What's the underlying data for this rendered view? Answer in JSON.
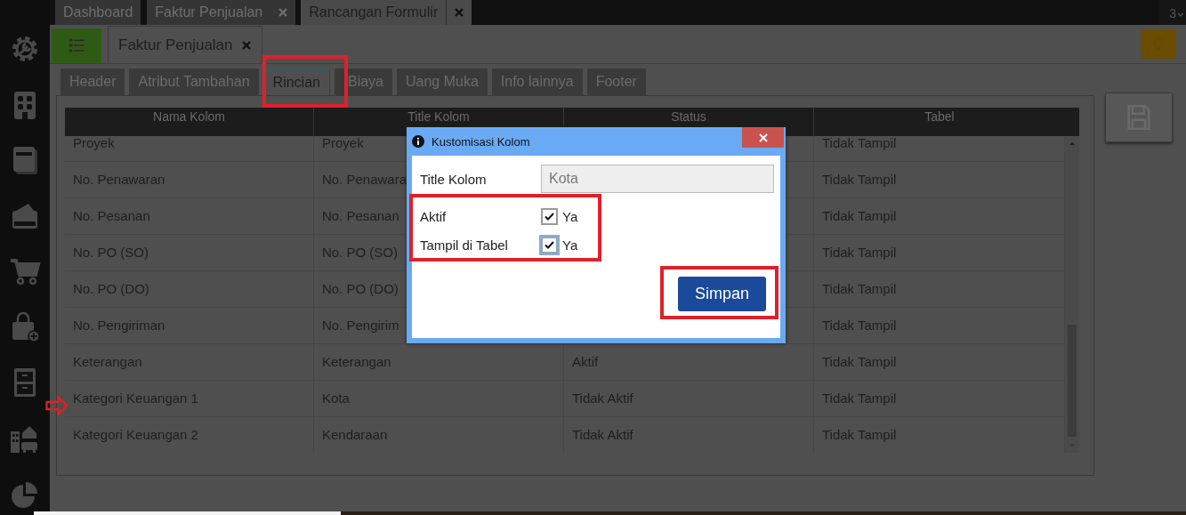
{
  "top_tabs": [
    {
      "label": "Dashboard",
      "selected": false,
      "closable": false
    },
    {
      "label": "Faktur Penjualan",
      "selected": false,
      "closable": true
    },
    {
      "label": "Rancangan Formulir",
      "selected": true,
      "closable": true
    }
  ],
  "tab_count": "3",
  "doc_tabs": [
    {
      "label": "Faktur Penjualan",
      "selected": true
    }
  ],
  "form_tabs": [
    {
      "label": "Header",
      "selected": false
    },
    {
      "label": "Atribut Tambahan",
      "selected": false
    },
    {
      "label": "Rincian",
      "selected": true
    },
    {
      "label": "Biaya",
      "selected": false
    },
    {
      "label": "Uang Muka",
      "selected": false
    },
    {
      "label": "Info lainnya",
      "selected": false
    },
    {
      "label": "Footer",
      "selected": false
    }
  ],
  "table": {
    "columns": [
      "Nama Kolom",
      "Title Kolom",
      "Status",
      "Tabel"
    ],
    "rows": [
      {
        "cells": [
          "Proyek",
          "Proyek",
          null,
          "Tidak Tampil"
        ]
      },
      {
        "cells": [
          "No. Penawaran",
          "No. Penawara",
          null,
          "Tidak Tampil"
        ]
      },
      {
        "cells": [
          "No. Pesanan",
          "No. Pesanan",
          null,
          "Tidak Tampil"
        ]
      },
      {
        "cells": [
          "No. PO (SO)",
          "No. PO (SO)",
          null,
          "Tidak Tampil"
        ]
      },
      {
        "cells": [
          "No. PO (DO)",
          "No. PO (DO)",
          null,
          "Tidak Tampil"
        ]
      },
      {
        "cells": [
          "No. Pengiriman",
          "No. Pengirim",
          null,
          "Tidak Tampil"
        ]
      },
      {
        "cells": [
          "Keterangan",
          "Keterangan",
          "Aktif",
          "Tidak Tampil"
        ]
      },
      {
        "cells": [
          "Kategori Keuangan 1",
          "Kota",
          "Tidak Aktif",
          "Tidak Tampil"
        ]
      },
      {
        "cells": [
          "Kategori Keuangan 2",
          "Kendaraan",
          "Tidak Aktif",
          "Tidak Tampil"
        ]
      }
    ]
  },
  "dialog": {
    "title": "Kustomisasi Kolom",
    "fields": [
      {
        "kind": "text",
        "label": "Title Kolom",
        "value": "Kota"
      },
      {
        "kind": "checkbox",
        "label": "Aktif",
        "option": "Ya",
        "checked": true,
        "focused": false
      },
      {
        "kind": "checkbox",
        "label": "Tampil di Tabel",
        "option": "Ya",
        "checked": true,
        "focused": true
      }
    ],
    "button": "Simpan"
  }
}
